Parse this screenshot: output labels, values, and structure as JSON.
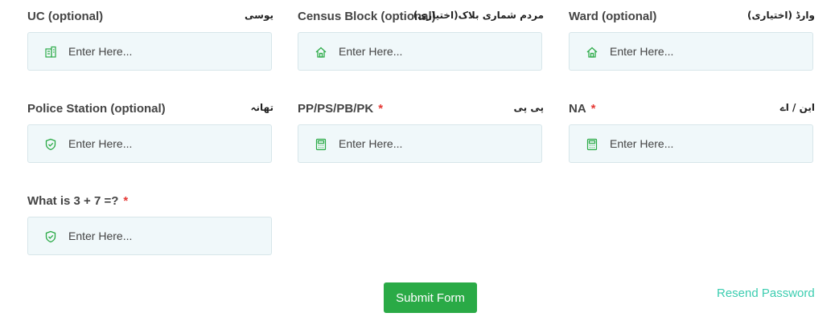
{
  "fields": [
    {
      "label": "UC (optional)",
      "urdu": "یوسی",
      "placeholder": "Enter Here...",
      "required": false,
      "icon": "building-icon"
    },
    {
      "label": "Census Block (optional)",
      "urdu": "مردم شماری بلاک(اختیاری)",
      "placeholder": "Enter Here...",
      "required": false,
      "icon": "home-icon"
    },
    {
      "label": "Ward (optional)",
      "urdu": "وارڈ (اختیاری)",
      "placeholder": "Enter Here...",
      "required": false,
      "icon": "home-icon"
    },
    {
      "label": "Police Station (optional)",
      "urdu": "تھانہ",
      "placeholder": "Enter Here...",
      "required": false,
      "icon": "shield-check-icon"
    },
    {
      "label": "PP/PS/PB/PK",
      "urdu": "پی پی",
      "placeholder": "Enter Here...",
      "required": true,
      "icon": "calculator-icon"
    },
    {
      "label": "NA",
      "urdu": "این / اے",
      "placeholder": "Enter Here...",
      "required": true,
      "icon": "calculator-icon"
    },
    {
      "label": "What is 3 + 7 =?",
      "urdu": "",
      "placeholder": "Enter Here...",
      "required": true,
      "icon": "shield-check-icon"
    }
  ],
  "required_marker": "*",
  "submit_label": "Submit Form",
  "resend_label": "Resend Password",
  "colors": {
    "accent": "#2aaa46",
    "link": "#3ccdb0",
    "required": "#e53935",
    "input_bg": "#f0f8fa",
    "icon": "#2aaa46"
  }
}
